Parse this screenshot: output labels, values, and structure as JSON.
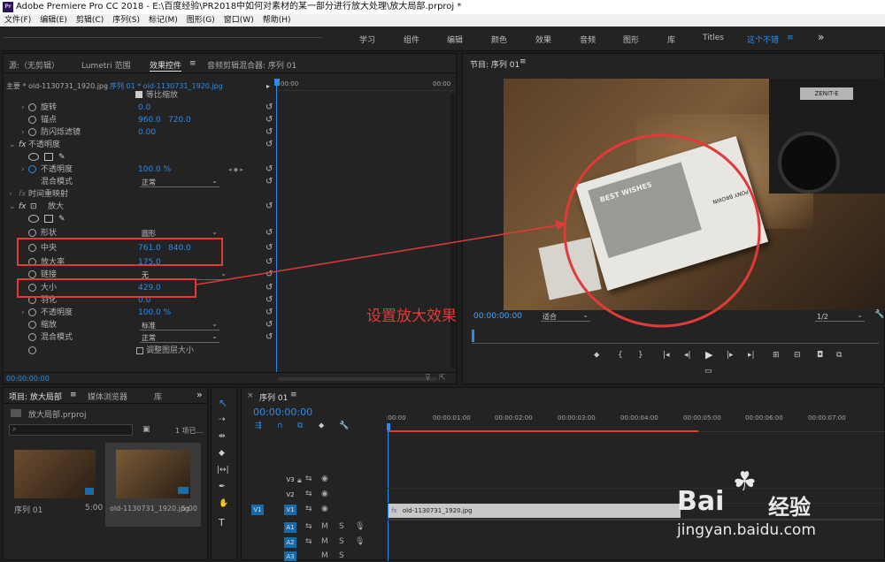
{
  "title": "Adobe Premiere Pro CC 2018 - E:\\百度经验\\PR2018中如何对素材的某一部分进行放大处理\\放大局部.prproj *",
  "app_icon": "Pr",
  "menu": [
    "文件(F)",
    "编辑(E)",
    "剪辑(C)",
    "序列(S)",
    "标记(M)",
    "图形(G)",
    "窗口(W)",
    "帮助(H)"
  ],
  "workspaces": [
    "学习",
    "组件",
    "编辑",
    "颜色",
    "效果",
    "音频",
    "图形",
    "库",
    "Titles",
    "这个不错"
  ],
  "workspace_more": "»",
  "source_tabs": [
    "源:（无剪辑）",
    "Lumetri 范围",
    "效果控件",
    "音频剪辑混合器: 序列 01"
  ],
  "ec": {
    "master": "主要 * old-1130731_1920.jpg",
    "seq": "序列 01 * old-1130731_1920.jpg",
    "time_start": "00:00",
    "time_end": "00:00",
    "current_time": "00:00:00:00",
    "uniform": "等比缩放",
    "rotation_label": "旋转",
    "rotation_val": "0.0",
    "anchor_label": "锚点",
    "anchor_x": "960.0",
    "anchor_y": "720.0",
    "flicker_label": "防闪烁滤镜",
    "flicker_val": "0.00",
    "opacity_header": "不透明度",
    "opacity_label": "不透明度",
    "opacity_val": "100.0 %",
    "blend_label": "混合模式",
    "blend_val": "正常",
    "remap_label": "时间重映射",
    "magnify_label": "放大",
    "shape_label": "形状",
    "shape_val": "圆形",
    "center_label": "中央",
    "center_x": "761.0",
    "center_y": "840.0",
    "zoom_label": "放大率",
    "zoom_val": "175.0",
    "link_label": "链接",
    "link_val": "无",
    "size_label": "大小",
    "size_val": "429.0",
    "feather_label": "羽化",
    "feather_val": "0.0",
    "opacity2_label": "不透明度",
    "opacity2_val": "100.0 %",
    "scale_label": "缩放",
    "scale_val": "标准",
    "blend2_label": "混合模式",
    "blend2_val": "正常",
    "adjust_layer": "调整图层大小"
  },
  "program": {
    "title": "节目: 序列 01",
    "timecode": "00:00:00:00",
    "fit": "适合",
    "res": "1/2",
    "annotation": "设置放大效果",
    "card_text_1": "BEST WISHES",
    "card_text_2": "PONY BROWN"
  },
  "project": {
    "tabs": [
      "项目: 放大局部",
      "媒体浏览器",
      "库"
    ],
    "file": "放大局部.prproj",
    "count": "1 项已...",
    "items": [
      {
        "name": "序列 01",
        "dur": "5:00"
      },
      {
        "name": "old-1130731_1920.jpg",
        "dur": "5:00"
      }
    ]
  },
  "timeline": {
    "title": "序列 01",
    "timecode": "00:00:00:00",
    "ticks": [
      ":00:00",
      "00:00:01:00",
      "00:00:02:00",
      "00:00:03:00",
      "00:00:04:00",
      "00:00:05:00",
      "00:00:06:00",
      "00:00:07:00"
    ],
    "tracks": [
      "V3",
      "V2",
      "V1",
      "A1",
      "A2",
      "A3"
    ],
    "clip": "old-1130731_1920.jpg",
    "clip_fx": "fx",
    "src_v1": "V1",
    "m": "M",
    "s": "S"
  },
  "watermark": {
    "brand": "Bai",
    "brand2": "经验",
    "url": "jingyan.baidu.com"
  },
  "colors": {
    "accent": "#2d8ceb",
    "highlight": "#e03a3a",
    "clip": "#c8c8c8"
  }
}
